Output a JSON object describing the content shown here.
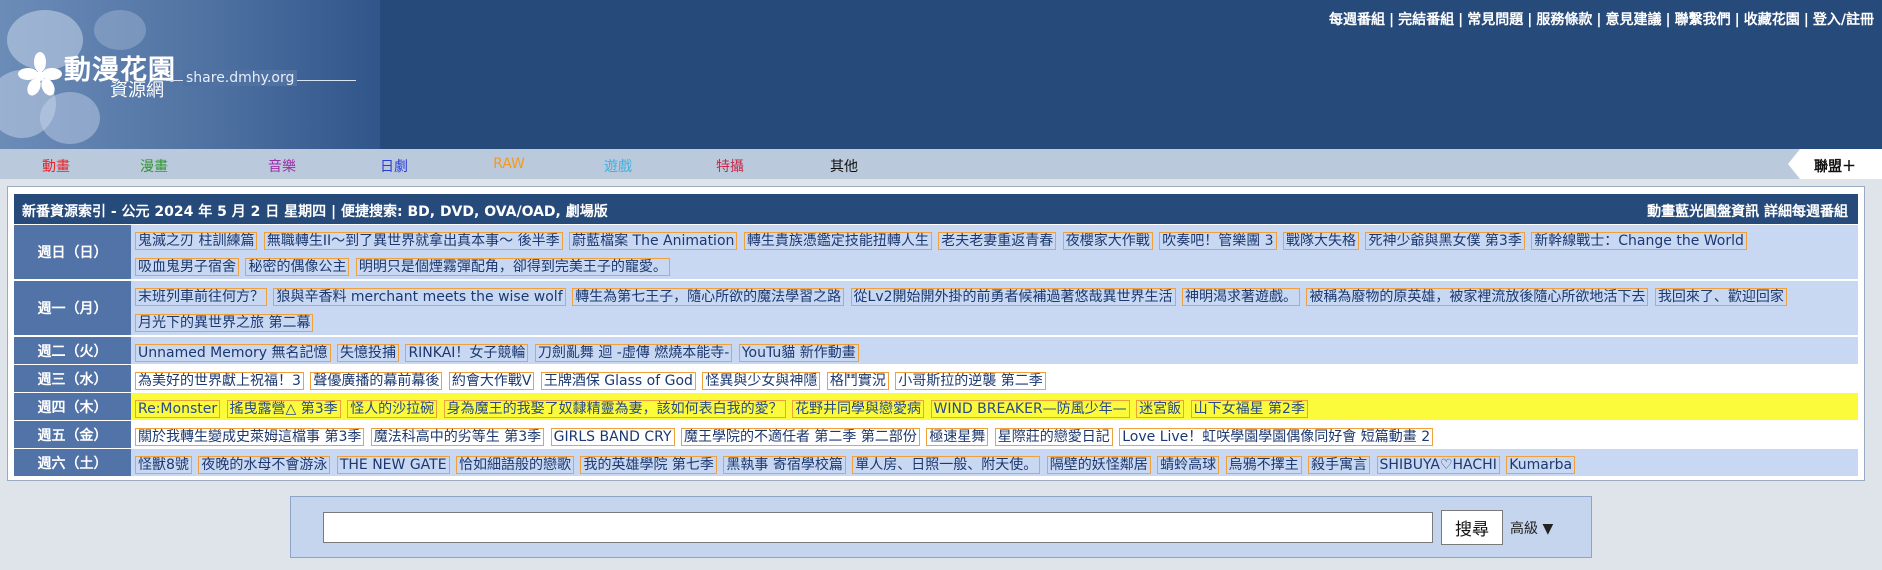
{
  "site": {
    "logo_title": "動漫花園",
    "logo_subtitle": "資源網",
    "logo_url": "share.dmhy.org"
  },
  "top_links": [
    "每週番組",
    "完結番組",
    "常見問題",
    "服務條款",
    "意見建議",
    "聯繫我們",
    "收藏花園",
    "登入/註冊"
  ],
  "categories": [
    {
      "label": "動畫",
      "color": "#e8242c"
    },
    {
      "label": "漫畫",
      "color": "#2e9a2e"
    },
    {
      "label": "音樂",
      "color": "#9b2fa8"
    },
    {
      "label": "日劇",
      "color": "#2a3cd6"
    },
    {
      "label": "RAW",
      "color": "#f59a1c"
    },
    {
      "label": "遊戲",
      "color": "#3cb2e6"
    },
    {
      "label": "特攝",
      "color": "#c82a4a"
    },
    {
      "label": "其他",
      "color": "#111111"
    }
  ],
  "union_label": "聯盟＋",
  "schedule": {
    "header_left": "新番資源索引 - 公元 2024 年 5 月 2 日 星期四 | 便捷搜索: BD, DVD, OVA/OAD, 劇場版",
    "header_right": "動畫藍光圓盤資訊 詳細每週番組",
    "days": [
      {
        "label": "週日（日）",
        "items": [
          "鬼滅之刃 柱訓練篇",
          "無職轉生II～到了異世界就拿出真本事～ 後半季",
          "蔚藍檔案 The Animation",
          "轉生貴族憑鑑定技能扭轉人生",
          "老夫老妻重返青春",
          "夜櫻家大作戰",
          "吹奏吧！管樂團 3",
          "戰隊大失格",
          "死神少爺與黑女僕 第3季",
          "新幹線戰士：Change the World",
          "吸血鬼男子宿舍",
          "秘密的偶像公主",
          "明明只是個煙霧彈配角，卻得到完美王子的寵愛。"
        ]
      },
      {
        "label": "週一（月）",
        "items": [
          "末班列車前往何方？",
          "狼與辛香料 merchant meets the wise wolf",
          "轉生為第七王子，隨心所欲的魔法學習之路",
          "從Lv2開始開外掛的前勇者候補過著悠哉異世界生活",
          "神明渴求著遊戲。",
          "被稱為廢物的原英雄，被家裡流放後隨心所欲地活下去",
          "我回來了、歡迎回家",
          "月光下的異世界之旅 第二幕"
        ]
      },
      {
        "label": "週二（火）",
        "items": [
          "Unnamed Memory 無名記憶",
          "失憶投捕",
          "RINKAI！女子競輪",
          "刀劍亂舞 迴 -虛傳 燃燒本能寺-",
          "YouTu貓 新作動畫"
        ]
      },
      {
        "label": "週三（水）",
        "items": [
          "為美好的世界獻上祝福！3",
          "聲優廣播的幕前幕後",
          "約會大作戰V",
          "王牌酒保 Glass of God",
          "怪異與少女與神隱",
          "格鬥實況",
          "小哥斯拉的逆襲 第二季"
        ]
      },
      {
        "label": "週四（木）",
        "items": [
          "Re:Monster",
          "搖曳露營△ 第3季",
          "怪人的沙拉碗",
          "身為魔王的我娶了奴隸精靈為妻，該如何表白我的愛？",
          "花野井同學與戀愛病",
          "WIND BREAKER—防風少年—",
          "迷宮飯",
          "山下女福星 第2季"
        ]
      },
      {
        "label": "週五（金）",
        "items": [
          "關於我轉生變成史萊姆這檔事 第3季",
          "魔法科高中的劣等生 第3季",
          "GIRLS BAND CRY",
          "魔王學院的不適任者 第二季 第二部份",
          "極速星舞",
          "星際莊的戀愛日記",
          "Love Live！虹咲學園學園偶像同好會 短篇動畫 2"
        ]
      },
      {
        "label": "週六（土）",
        "items": [
          "怪獸8號",
          "夜晚的水母不會游泳",
          "THE NEW GATE",
          "恰如細語般的戀歌",
          "我的英雄學院 第七季",
          "黑執事 寄宿學校篇",
          "單人房、日照一般、附天使。",
          "隔壁的妖怪鄰居",
          "蜻蛉高球",
          "烏鴉不擇主",
          "殺手寓言",
          "SHIBUYA♡HACHI",
          "Kumarba"
        ]
      }
    ]
  },
  "search": {
    "placeholder": "",
    "button_label": "搜尋",
    "advanced_label": "高級 ▼"
  }
}
